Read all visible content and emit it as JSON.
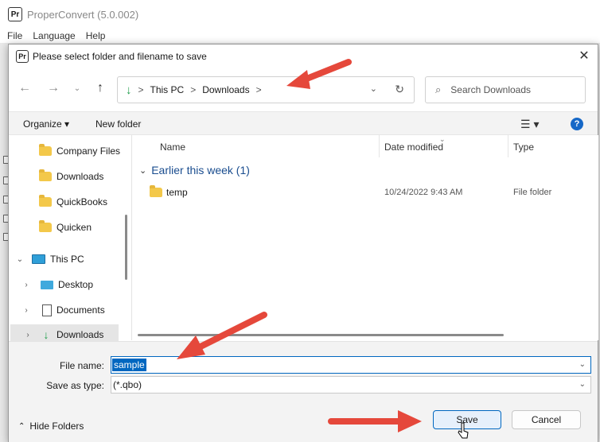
{
  "app": {
    "logo": "Pr",
    "title": "ProperConvert (5.0.002)",
    "menu": [
      "File",
      "Language",
      "Help"
    ]
  },
  "dialog": {
    "logo": "Pr",
    "title": "Please select folder and filename to save",
    "close_icon": "close-icon",
    "address": {
      "crumbs": [
        "This PC",
        "Downloads"
      ],
      "separator": ">",
      "dropdown_icon": "chevron-down-icon",
      "refresh_icon": "refresh-icon"
    },
    "search": {
      "placeholder": "Search Downloads"
    },
    "toolbar": {
      "organize": "Organize ▾",
      "new_folder": "New folder",
      "view_icon": "view-icon",
      "help": "?"
    },
    "nav_items": [
      {
        "label": "Company Files",
        "icon": "folder-icon"
      },
      {
        "label": "Downloads",
        "icon": "folder-icon"
      },
      {
        "label": "QuickBooks",
        "icon": "folder-icon"
      },
      {
        "label": "Quicken",
        "icon": "folder-icon"
      },
      {
        "label": "This PC",
        "icon": "pc-icon"
      },
      {
        "label": "Desktop",
        "icon": "desktop-icon"
      },
      {
        "label": "Documents",
        "icon": "documents-icon"
      },
      {
        "label": "Downloads",
        "icon": "download-icon"
      }
    ],
    "columns": {
      "name": "Name",
      "date": "Date modified",
      "type": "Type"
    },
    "group": {
      "label": "Earlier this week (1)"
    },
    "files": [
      {
        "name": "temp",
        "date": "10/24/2022 9:43 AM",
        "type": "File folder"
      }
    ],
    "file_name": {
      "label": "File name:",
      "value": "sample"
    },
    "save_as_type": {
      "label": "Save as type:",
      "value": "(*.qbo)"
    },
    "hide_folders": "Hide Folders",
    "save_label": "Save",
    "cancel_label": "Cancel"
  },
  "colors": {
    "accent": "#0067c0",
    "annotation_arrow": "#e5483b",
    "folder": "#f3c84a"
  }
}
